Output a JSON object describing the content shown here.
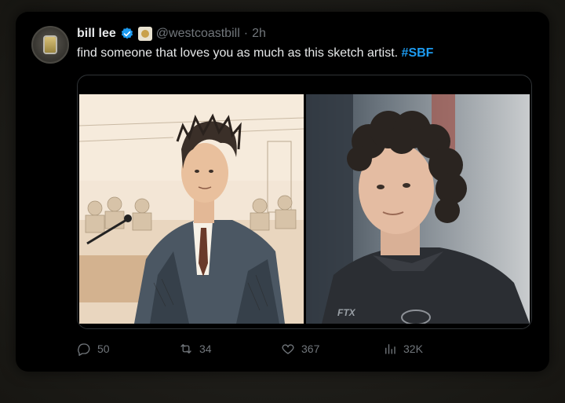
{
  "tweet": {
    "display_name": "bill lee",
    "handle": "@westcoastbill",
    "separator": "·",
    "time": "2h",
    "text_main": "find someone that loves you as much as this sketch artist.",
    "hashtag": "#SBF",
    "media": {
      "left_image": "courtroom-sketch",
      "right_image": "photo"
    },
    "stats": {
      "replies": "50",
      "retweets": "34",
      "likes": "367",
      "views": "32K"
    }
  },
  "colors": {
    "accent": "#1d9bf0",
    "muted": "#71767b",
    "text": "#e7e9ea",
    "card_bg": "#000000"
  }
}
